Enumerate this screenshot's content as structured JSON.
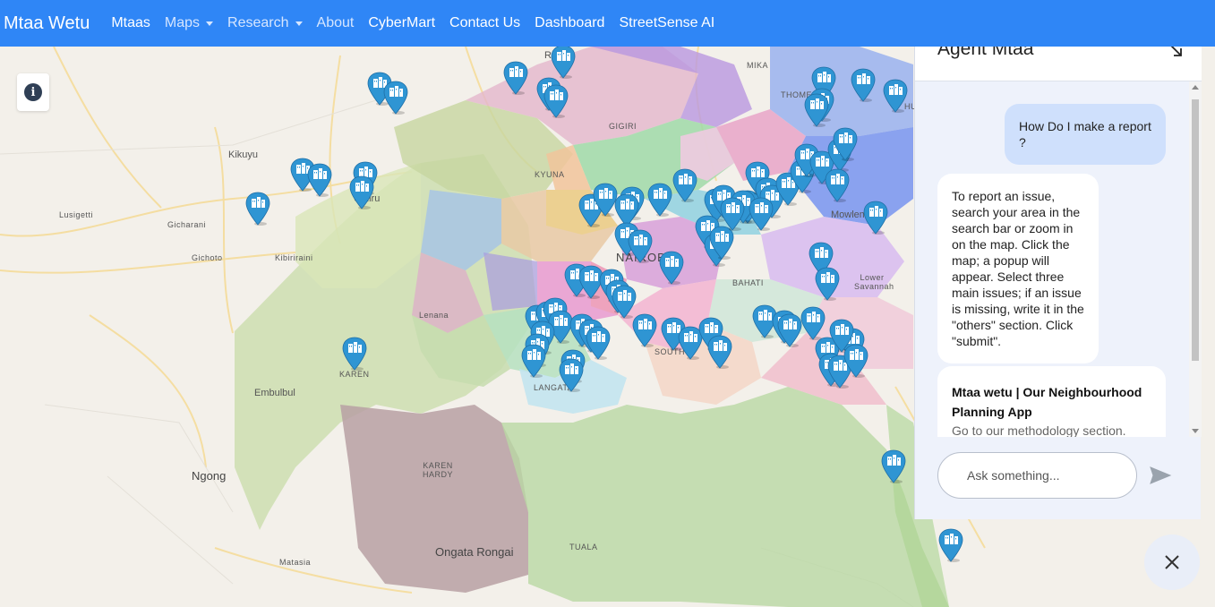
{
  "navbar": {
    "brand": "Mtaa Wetu",
    "items": [
      {
        "label": "Mtaas",
        "dropdown": false,
        "active": true
      },
      {
        "label": "Maps",
        "dropdown": true,
        "active": false
      },
      {
        "label": "Research",
        "dropdown": true,
        "active": false
      },
      {
        "label": "About",
        "dropdown": false,
        "active": false
      },
      {
        "label": "CyberMart",
        "dropdown": false,
        "active": true
      },
      {
        "label": "Contact Us",
        "dropdown": false,
        "active": true
      },
      {
        "label": "Dashboard",
        "dropdown": false,
        "active": true
      },
      {
        "label": "StreetSense AI",
        "dropdown": false,
        "active": true
      }
    ],
    "color": "#2f86f6"
  },
  "map": {
    "info_icon": "info-icon",
    "marker_icon": "building-marker-icon",
    "marker_color": "#2f95d3",
    "place_labels": [
      "Kikuyu",
      "Uthiru",
      "Lusigetti",
      "Gicharani",
      "Gichoto",
      "Kibiriraini",
      "Lenana",
      "KAREN",
      "Embulbul",
      "Ngong",
      "KAREN HARDY",
      "Matasia",
      "Ongata Rongai",
      "TUALA",
      "LANGATA",
      "SOUTH C",
      "BAHATI",
      "Mowlem",
      "Lower Savannah",
      "MIKA",
      "THOME",
      "GIGIRI",
      "KYUNA",
      "NAIROBI",
      "Ruaka",
      "HU"
    ]
  },
  "chat": {
    "title": "Agent Mtaa",
    "minimize_icon": "minimize-arrow-icon",
    "user_message": "How Do I make a report ?",
    "bot_message": "To report an issue, search your area in the search bar or zoom in on the map. Click the map; a popup will appear. Select three main issues; if an issue is missing, write it in the \"others\" section. Click \"submit\".",
    "card": {
      "title": "Mtaa wetu | Our Neighbourhood Planning App",
      "subtitle": "Go to our methodology section."
    },
    "input_placeholder": "Ask something...",
    "send_icon": "send-icon",
    "scroll_icon": "arrow-down-icon",
    "close_icon": "close-icon"
  }
}
